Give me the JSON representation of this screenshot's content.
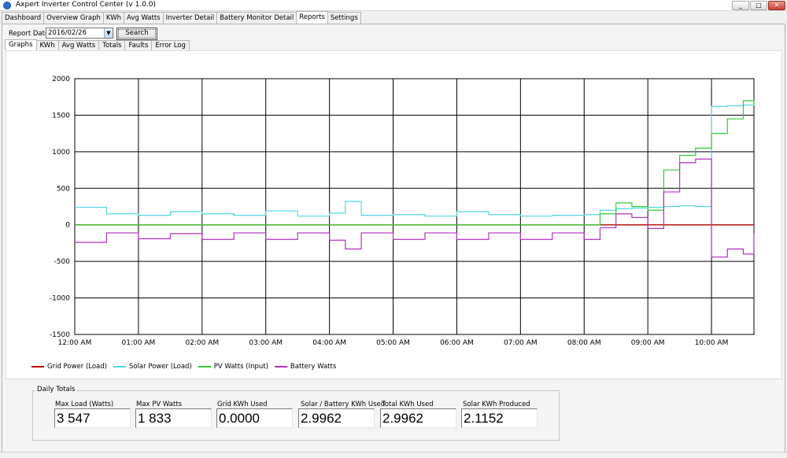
{
  "window": {
    "title": "Axpert Inverter Control Center  (v 1.0.0)"
  },
  "tabs": [
    "Dashboard",
    "Overview Graph",
    "KWh",
    "Avg Watts",
    "Inverter Detail",
    "Battery Monitor Detail",
    "Reports",
    "Settings"
  ],
  "active_tab": "Reports",
  "report": {
    "date_label": "Report Date",
    "date_value": "2016/02/26",
    "search_label": "Search"
  },
  "subtabs": [
    "Graphs",
    "KWh",
    "Avg Watts",
    "Totals",
    "Faults",
    "Error Log"
  ],
  "active_subtab": "Graphs",
  "chart_data": {
    "type": "line",
    "ylim": [
      -1500,
      2000
    ],
    "yticks": [
      "2000",
      "1500",
      "1000",
      "500",
      "0",
      "-500",
      "-1000",
      "-1500"
    ],
    "xticks": [
      "12:00 AM",
      "01:00 AM",
      "02:00 AM",
      "03:00 AM",
      "04:00 AM",
      "05:00 AM",
      "06:00 AM",
      "07:00 AM",
      "08:00 AM",
      "09:00 AM",
      "10:00 AM"
    ],
    "x": [
      "12:00 AM",
      "00:30",
      "01:00 AM",
      "01:30",
      "02:00 AM",
      "02:30",
      "03:00 AM",
      "03:30",
      "04:00 AM",
      "04:15",
      "04:30",
      "05:00 AM",
      "05:30",
      "06:00 AM",
      "06:30",
      "07:00 AM",
      "07:30",
      "08:00 AM",
      "08:15",
      "08:30",
      "08:45",
      "09:00 AM",
      "09:15",
      "09:30",
      "09:45",
      "10:00 AM",
      "10:15",
      "10:30",
      "10:40"
    ],
    "series": [
      {
        "name": "Grid Power (Load)",
        "color": "#c00000",
        "values": [
          0,
          0,
          0,
          0,
          0,
          0,
          0,
          0,
          0,
          0,
          0,
          0,
          0,
          0,
          0,
          0,
          0,
          0,
          0,
          0,
          0,
          0,
          0,
          0,
          0,
          0,
          0,
          0,
          0
        ]
      },
      {
        "name": "Solar Power (Load)",
        "color": "#4fd7e0",
        "values": [
          240,
          150,
          130,
          180,
          150,
          130,
          190,
          120,
          160,
          320,
          130,
          140,
          120,
          180,
          140,
          120,
          130,
          140,
          200,
          220,
          230,
          240,
          250,
          260,
          250,
          1620,
          1630,
          1640,
          1680
        ]
      },
      {
        "name": "PV Watts (Input)",
        "color": "#33cc33",
        "values": [
          0,
          0,
          0,
          0,
          0,
          0,
          0,
          0,
          0,
          0,
          0,
          0,
          0,
          0,
          0,
          0,
          0,
          0,
          150,
          300,
          250,
          200,
          750,
          950,
          1050,
          1250,
          1450,
          1700,
          1650
        ]
      },
      {
        "name": "Battery Watts",
        "color": "#b030c0",
        "values": [
          -240,
          -110,
          -190,
          -120,
          -200,
          -110,
          -200,
          -110,
          -210,
          -330,
          -110,
          -200,
          -110,
          -200,
          -110,
          -200,
          -110,
          -200,
          -40,
          150,
          100,
          -50,
          450,
          850,
          900,
          -440,
          -330,
          -400,
          -120
        ]
      }
    ]
  },
  "daily_totals": {
    "title": "Daily Totals",
    "items": [
      {
        "label": "Max Load (Watts)",
        "value": "3 547"
      },
      {
        "label": "Max PV Watts",
        "value": "1 833"
      },
      {
        "label": "Grid KWh Used",
        "value": "0.0000"
      },
      {
        "label": "Solar / Battery KWh Used",
        "value": "2.9962"
      },
      {
        "label": "Total KWh Used",
        "value": "2.9962"
      },
      {
        "label": "Solar KWh Produced",
        "value": "2.1152"
      }
    ]
  }
}
